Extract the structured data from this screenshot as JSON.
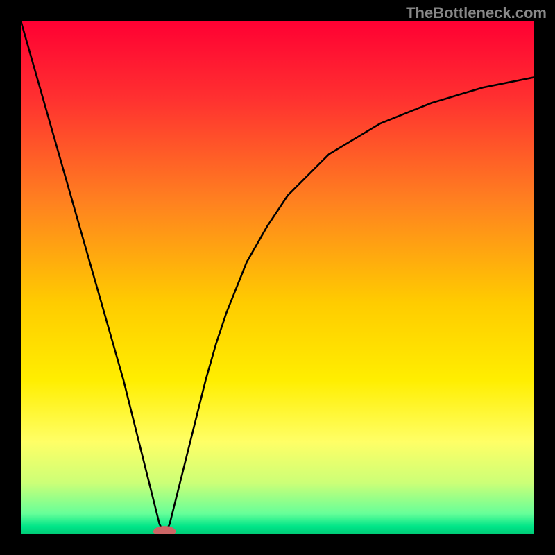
{
  "watermark": "TheBottleneck.com",
  "chart_data": {
    "type": "line",
    "title": "",
    "xlabel": "",
    "ylabel": "",
    "xlim": [
      0,
      100
    ],
    "ylim": [
      0,
      100
    ],
    "grid": false,
    "background_gradient": {
      "stops": [
        {
          "pos": 0.0,
          "color": "#ff0033"
        },
        {
          "pos": 0.15,
          "color": "#ff3030"
        },
        {
          "pos": 0.35,
          "color": "#ff8020"
        },
        {
          "pos": 0.55,
          "color": "#ffcc00"
        },
        {
          "pos": 0.7,
          "color": "#ffee00"
        },
        {
          "pos": 0.82,
          "color": "#ffff66"
        },
        {
          "pos": 0.9,
          "color": "#ccff77"
        },
        {
          "pos": 0.96,
          "color": "#66ff99"
        },
        {
          "pos": 0.985,
          "color": "#00e588"
        },
        {
          "pos": 1.0,
          "color": "#00cc77"
        }
      ]
    },
    "series": [
      {
        "name": "bottleneck-curve",
        "color": "#000000",
        "x": [
          0,
          2,
          4,
          6,
          8,
          10,
          12,
          14,
          16,
          18,
          20,
          22,
          24,
          26,
          27,
          28,
          29,
          30,
          32,
          34,
          36,
          38,
          40,
          44,
          48,
          52,
          56,
          60,
          65,
          70,
          75,
          80,
          85,
          90,
          95,
          100
        ],
        "values": [
          100,
          93,
          86,
          79,
          72,
          65,
          58,
          51,
          44,
          37,
          30,
          22,
          14,
          6,
          2,
          0,
          2,
          6,
          14,
          22,
          30,
          37,
          43,
          53,
          60,
          66,
          70,
          74,
          77,
          80,
          82,
          84,
          85.5,
          87,
          88,
          89
        ]
      }
    ],
    "marker": {
      "x": 28,
      "y": 0.5,
      "rx": 2.2,
      "ry": 1.1,
      "color": "#cc6666"
    }
  }
}
